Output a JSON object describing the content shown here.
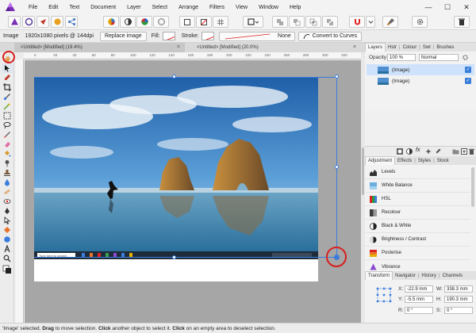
{
  "menu": {
    "items": [
      "File",
      "Edit",
      "Text",
      "Document",
      "Layer",
      "Select",
      "Arrange",
      "Filters",
      "View",
      "Window",
      "Help"
    ]
  },
  "window": {
    "minimize": "—",
    "maximize": "☐",
    "close": "✕"
  },
  "context": {
    "object_type": "Image",
    "info": "1920x1080 pixels @ 144dpi",
    "replace_image": "Replace image",
    "fill_label": "Fill:",
    "stroke_label": "Stroke:",
    "stroke_style": "None",
    "convert_to_curves": "Convert to Curves"
  },
  "tabs": [
    {
      "label": "<Untitled> [Modified] (19.4%)",
      "active": true,
      "close": "×"
    },
    {
      "label": "<Untitled> [Modified] (20.0%)",
      "active": false,
      "close": "×"
    }
  ],
  "rulers": {
    "h_ticks": [
      "0",
      "20",
      "40",
      "60",
      "80",
      "100",
      "120",
      "140",
      "160",
      "180",
      "200",
      "220",
      "240",
      "260",
      "280",
      "300",
      "320"
    ]
  },
  "layers_panel": {
    "tabs": [
      "Layers",
      "Hstr",
      "Colour",
      "Swt",
      "Brushes"
    ],
    "opacity_label": "Opacity:",
    "opacity_value": "100 %",
    "blend_mode": "Normal",
    "layers": [
      {
        "name": "(Image)",
        "selected": true,
        "check": "✓"
      },
      {
        "name": "(Image)",
        "selected": false,
        "check": "✓"
      }
    ]
  },
  "adjustment_panel": {
    "tabs": [
      "Adjustment",
      "Effects",
      "Styles",
      "Stock"
    ],
    "items": [
      "Levels",
      "White Balance",
      "HSL",
      "Recolour",
      "Black & White",
      "Brightness / Contrast",
      "Posterise",
      "Vibrance"
    ]
  },
  "transform_panel": {
    "tabs": [
      "Transform",
      "Navigator",
      "History",
      "Channels"
    ],
    "x_label": "X:",
    "x_value": "-22.9 mm",
    "y_label": "Y:",
    "y_value": "-5.5 mm",
    "w_label": "W:",
    "w_value": "338.3 mm",
    "h_label": "H:",
    "h_value": "190.3 mm",
    "r_label": "R:",
    "r_value": "0 °",
    "s_label": "S:",
    "s_value": "0 °"
  },
  "status": {
    "q1": "'Image'",
    "t1": " selected. ",
    "b1": "Drag",
    "t2": " to move selection. ",
    "b2": "Click",
    "t3": " another object to select it. ",
    "b3": "Click",
    "t4": " on an empty area to deselect selection."
  },
  "taskbar": {
    "search_placeholder": "Type here to search"
  },
  "colors": {
    "accent": "#3c7ddb",
    "selection_row": "#cfe2fb",
    "annotation_red": "#d81e1e"
  }
}
